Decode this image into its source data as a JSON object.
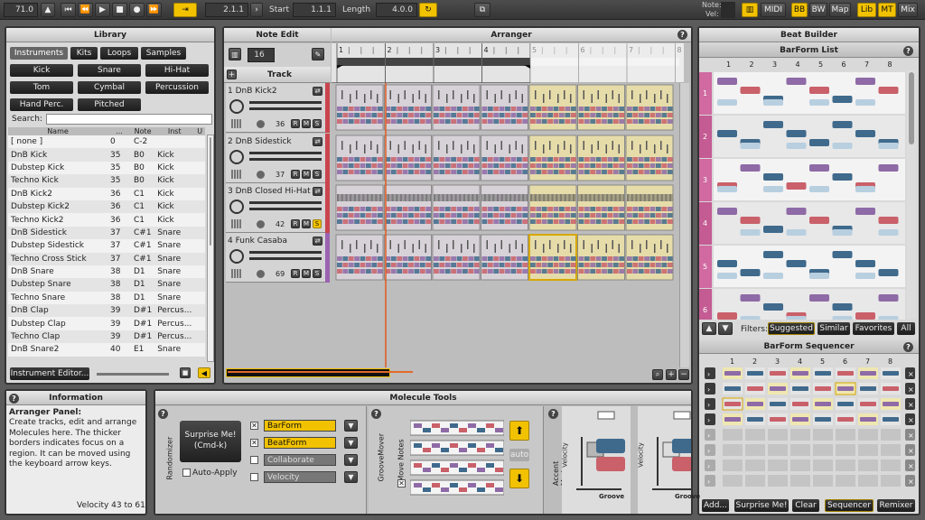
{
  "toolbar": {
    "tempo": "71.0",
    "start_label": "Start",
    "start_value": "1.1.1",
    "length_label": "Length",
    "length_value": "4.0.0",
    "position": "2.1.1",
    "note_label": "Note:",
    "vel_label": "Vel:",
    "midi": "MIDI",
    "bb": "BB",
    "bw": "BW",
    "map": "Map",
    "lib": "Lib",
    "mt": "MT",
    "mix": "Mix"
  },
  "library": {
    "title": "Library",
    "tabs": [
      "Instruments",
      "Kits",
      "Loops",
      "Samples"
    ],
    "categories": [
      "Kick",
      "Snare",
      "Hi-Hat",
      "Tom",
      "Cymbal",
      "Percussion",
      "Hand Perc.",
      "Pitched"
    ],
    "search_label": "Search:",
    "columns": [
      "Name",
      "...",
      "Note",
      "Inst",
      "U"
    ],
    "rows": [
      [
        "[ none ]",
        "0",
        "C-2",
        ""
      ],
      [
        "DnB Kick",
        "35",
        "B0",
        "Kick"
      ],
      [
        "Dubstep Kick",
        "35",
        "B0",
        "Kick"
      ],
      [
        "Techno Kick",
        "35",
        "B0",
        "Kick"
      ],
      [
        "DnB Kick2",
        "36",
        "C1",
        "Kick"
      ],
      [
        "Dubstep Kick2",
        "36",
        "C1",
        "Kick"
      ],
      [
        "Techno Kick2",
        "36",
        "C1",
        "Kick"
      ],
      [
        "DnB Sidestick",
        "37",
        "C#1",
        "Snare"
      ],
      [
        "Dubstep Sidestick",
        "37",
        "C#1",
        "Snare"
      ],
      [
        "Techno Cross Stick",
        "37",
        "C#1",
        "Snare"
      ],
      [
        "DnB Snare",
        "38",
        "D1",
        "Snare"
      ],
      [
        "Dubstep Snare",
        "38",
        "D1",
        "Snare"
      ],
      [
        "Techno Snare",
        "38",
        "D1",
        "Snare"
      ],
      [
        "DnB Clap",
        "39",
        "D#1",
        "Percus..."
      ],
      [
        "Dubstep Clap",
        "39",
        "D#1",
        "Percus..."
      ],
      [
        "Techno Clap",
        "39",
        "D#1",
        "Percus..."
      ],
      [
        "DnB Snare2",
        "40",
        "E1",
        "Snare"
      ]
    ],
    "editor_button": "Instrument Editor..."
  },
  "note_edit": {
    "title": "Note Edit",
    "value": "16",
    "track_label": "Track"
  },
  "arranger": {
    "title": "Arranger",
    "bars": [
      "1",
      "2",
      "3",
      "4",
      "5",
      "6",
      "7",
      "8"
    ]
  },
  "tracks": [
    {
      "name": "1 DnB Kick2",
      "vel": "36"
    },
    {
      "name": "2 DnB Sidestick",
      "vel": "37"
    },
    {
      "name": "3 DnB Closed Hi-Hat",
      "vel": "42"
    },
    {
      "name": "4 Funk Casaba",
      "vel": "69"
    }
  ],
  "track_buttons": {
    "r": "R",
    "m": "M",
    "s": "S"
  },
  "beat_builder": {
    "title": "Beat Builder",
    "barform_title": "BarForm List",
    "cols": [
      "1",
      "2",
      "3",
      "4",
      "5",
      "6",
      "7",
      "8"
    ],
    "rows": [
      "1",
      "2",
      "3",
      "4",
      "5",
      "6"
    ],
    "filters_label": "Filters:",
    "filters": [
      "Suggested",
      "Similar",
      "Favorites",
      "All"
    ],
    "seq_title": "BarForm Sequencer",
    "bottom": [
      "Add...",
      "Surprise Me!",
      "Clear",
      "Sequencer",
      "Remixer"
    ]
  },
  "info": {
    "title": "Information",
    "heading": "Arranger Panel:",
    "body": "Create tracks, edit and arrange Molecules here. The thicker borders indicates focus on a region. It can be moved using the keyboard arrow keys.",
    "footer": "Velocity 43 to 61"
  },
  "molecule": {
    "title": "Molecule Tools",
    "randomizer": "Randomizer",
    "surprise": "Surprise Me! (Cmd-k)",
    "auto_apply": "Auto-Apply",
    "opts": [
      "BarForm",
      "BeatForm",
      "Collaborate",
      "Velocity"
    ],
    "groove_mover": "GrooveMover",
    "move_notes": "Move Notes",
    "auto": "auto",
    "accent": "Accent Mods",
    "velocity": "Velocity",
    "groove": "Groove"
  },
  "colors": {
    "accent": "#f2c200",
    "purple": "#8e6aa6",
    "blue": "#3f6a8c",
    "red": "#c9606a"
  }
}
